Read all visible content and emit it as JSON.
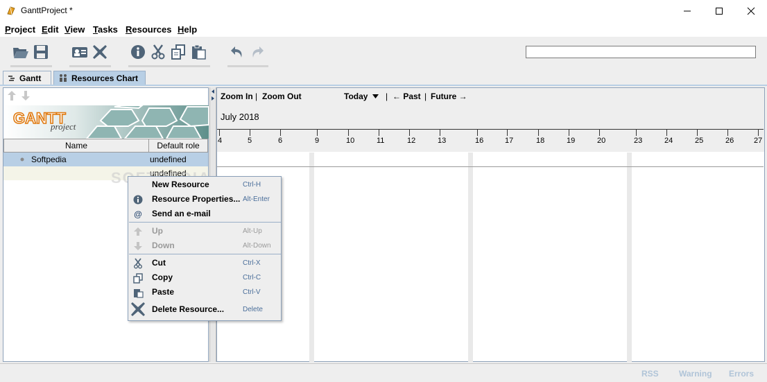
{
  "window": {
    "title": "GanttProject *"
  },
  "menu": [
    "Project",
    "Edit",
    "View",
    "Tasks",
    "Resources",
    "Help"
  ],
  "toolbar": {
    "icons": [
      "open-folder-icon",
      "save-icon",
      "resource-card-icon",
      "delete-icon",
      "info-icon",
      "cut-icon",
      "copy-icon",
      "paste-icon",
      "undo-icon",
      "redo-icon"
    ],
    "search_value": ""
  },
  "tabs": [
    {
      "label": "Gantt"
    },
    {
      "label": "Resources Chart"
    }
  ],
  "resource_table": {
    "columns": [
      "Name",
      "Default role"
    ],
    "rows": [
      {
        "name": "Softpedia",
        "role": "undefined"
      },
      {
        "name": "",
        "role": "undefined"
      }
    ]
  },
  "logo": {
    "text_main": "GANTT",
    "text_sub": "project"
  },
  "chart": {
    "zoom_in": "Zoom In",
    "zoom_out": "Zoom Out",
    "today": "Today",
    "past": "← Past",
    "future": "Future →",
    "sep": "|",
    "month": "July 2018",
    "days": [
      "4",
      "5",
      "6",
      "9",
      "10",
      "11",
      "12",
      "13",
      "16",
      "17",
      "18",
      "19",
      "20",
      "23",
      "24",
      "25",
      "26",
      "27"
    ]
  },
  "context_menu": [
    {
      "label": "New Resource",
      "shortcut": "Ctrl-H",
      "icon": "none",
      "enabled": true
    },
    {
      "label": "Resource Properties...",
      "shortcut": "Alt-Enter",
      "icon": "info-icon",
      "enabled": true
    },
    {
      "label": "Send an e-mail",
      "shortcut": "",
      "icon": "at-icon",
      "enabled": true
    },
    {
      "label": "Up",
      "shortcut": "Alt-Up",
      "icon": "arrow-up-icon",
      "enabled": false
    },
    {
      "label": "Down",
      "shortcut": "Alt-Down",
      "icon": "arrow-down-icon",
      "enabled": false
    },
    {
      "label": "Cut",
      "shortcut": "Ctrl-X",
      "icon": "cut-icon",
      "enabled": true
    },
    {
      "label": "Copy",
      "shortcut": "Ctrl-C",
      "icon": "copy-icon",
      "enabled": true
    },
    {
      "label": "Paste",
      "shortcut": "Ctrl-V",
      "icon": "paste-icon",
      "enabled": true
    },
    {
      "label": "Delete Resource...",
      "shortcut": "Delete",
      "icon": "delete-icon",
      "enabled": true
    }
  ],
  "status": {
    "rss": "RSS",
    "warning": "Warning",
    "errors": "Errors"
  },
  "watermark": "SOFTPEDIA",
  "colors": {
    "accent": "#4a6e9a",
    "selected_row": "#b8cfe5",
    "banner": "#6e9c98",
    "disabled": "#9a9a9a"
  }
}
